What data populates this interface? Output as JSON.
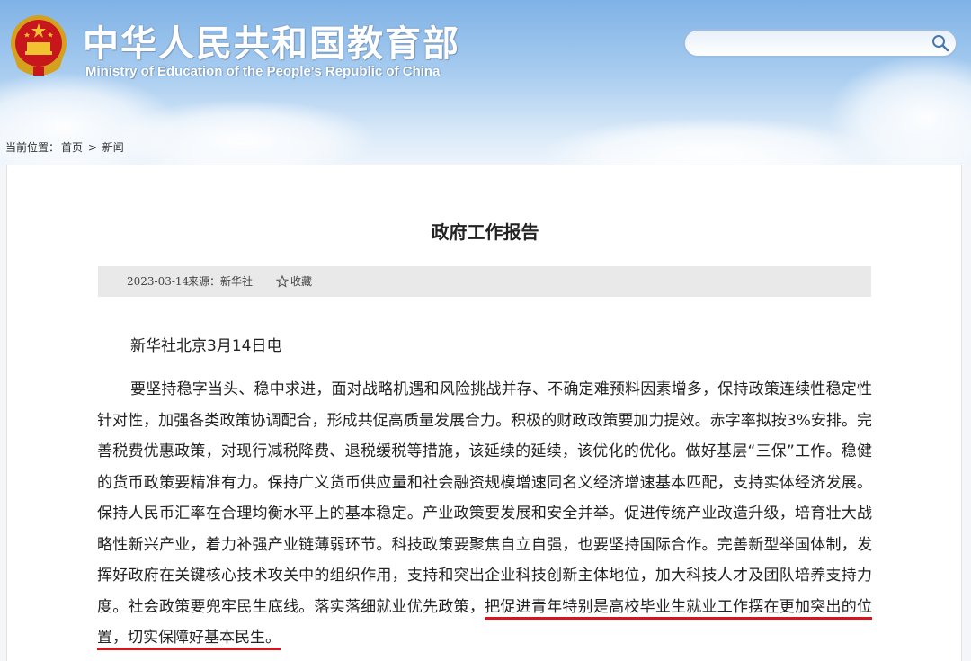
{
  "header": {
    "site_title": "中华人民共和国教育部",
    "site_subtitle": "Ministry of Education of the People's Republic of China",
    "search": {
      "placeholder": "",
      "value": ""
    },
    "search_icon": "search-icon",
    "emblem_icon": "national-emblem-icon"
  },
  "breadcrumb": {
    "prefix": "当前位置：",
    "home": "首页",
    "separator": " > ",
    "current": "新闻"
  },
  "article": {
    "title": "政府工作报告",
    "meta": {
      "date": "2023-03-14",
      "source": "来源：新华社",
      "favorite_label": "收藏",
      "favorite_icon": "star-outline-icon"
    },
    "dateline": "新华社北京3月14日电",
    "paragraph_plain": "要坚持稳字当头、稳中求进，面对战略机遇和风险挑战并存、不确定难预料因素增多，保持政策连续性稳定性针对性，加强各类政策协调配合，形成共促高质量发展合力。积极的财政政策要加力提效。赤字率拟按3%安排。完善税费优惠政策，对现行减税降费、退税缓税等措施，该延续的延续，该优化的优化。做好基层“三保”工作。稳健的货币政策要精准有力。保持广义货币供应量和社会融资规模增速同名义经济增速基本匹配，支持实体经济发展。保持人民币汇率在合理均衡水平上的基本稳定。产业政策要发展和安全并举。促进传统产业改造升级，培育壮大战略性新兴产业，着力补强产业链薄弱环节。科技政策要聚焦自立自强，也要坚持国际合作。完善新型举国体制，发挥好政府在关键核心技术攻关中的组织作用，支持和突出企业科技创新主体地位，加大科技人才及团队培养支持力度。社会政策要兜牢民生底线。落实落细就业优先政策，",
    "paragraph_highlight": "把促进青年特别是高校毕业生就业工作摆在更加突出的位置，切实保障好基本民生。",
    "highlight_color": "#d9141c"
  }
}
